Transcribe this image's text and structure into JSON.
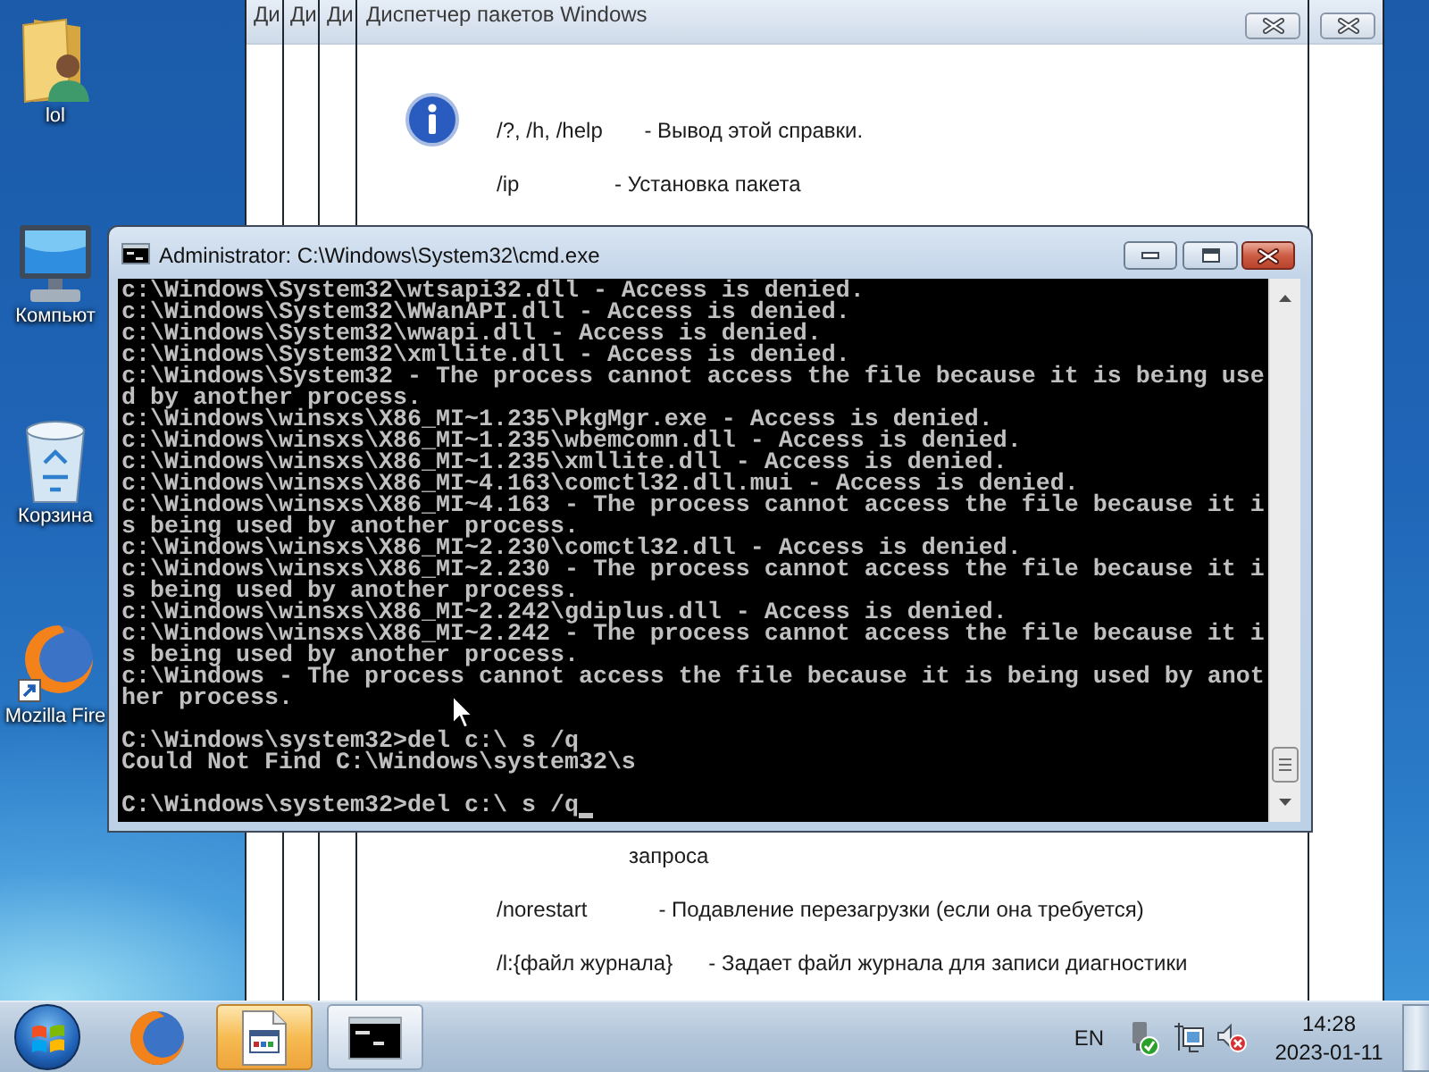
{
  "desktop_icons": [
    {
      "label": "lol",
      "kind": "user-folder"
    },
    {
      "label": "Компьют",
      "kind": "computer"
    },
    {
      "label": "Корзина",
      "kind": "recycle-bin"
    },
    {
      "label": "Mozilla Fire",
      "kind": "browser-shortcut"
    }
  ],
  "background_dialogs": [
    {
      "title": "Ди"
    },
    {
      "title": "Ди"
    },
    {
      "title": "Ди"
    }
  ],
  "package_manager_dialog": {
    "title": "Диспетчер пакетов Windows",
    "help_lines_top": [
      {
        "kind": "option",
        "text": "/?, /h, /help       - Вывод этой справки."
      },
      {
        "kind": "option",
        "text": "/ip                - Установка пакета"
      }
    ],
    "help_lines_bottom": [
      {
        "kind": "continuation",
        "text": "запроса"
      },
      {
        "kind": "option",
        "text": "/norestart            - Подавление перезагрузки (если она требуется)"
      },
      {
        "kind": "option",
        "text": "/l:{файл журнала}      - Задает файл журнала для записи диагностики"
      }
    ]
  },
  "console_window": {
    "title": "Administrator: C:\\Windows\\System32\\cmd.exe",
    "output": [
      "c:\\Windows\\System32\\wtsapi32.dll - Access is denied.",
      "c:\\Windows\\System32\\WWanAPI.dll - Access is denied.",
      "c:\\Windows\\System32\\wwapi.dll - Access is denied.",
      "c:\\Windows\\System32\\xmllite.dll - Access is denied.",
      "c:\\Windows\\System32 - The process cannot access the file because it is being use",
      "d by another process.",
      "c:\\Windows\\winsxs\\X86_MI~1.235\\PkgMgr.exe - Access is denied.",
      "c:\\Windows\\winsxs\\X86_MI~1.235\\wbemcomn.dll - Access is denied.",
      "c:\\Windows\\winsxs\\X86_MI~1.235\\xmllite.dll - Access is denied.",
      "c:\\Windows\\winsxs\\X86_MI~4.163\\comctl32.dll.mui - Access is denied.",
      "c:\\Windows\\winsxs\\X86_MI~4.163 - The process cannot access the file because it i",
      "s being used by another process.",
      "c:\\Windows\\winsxs\\X86_MI~2.230\\comctl32.dll - Access is denied.",
      "c:\\Windows\\winsxs\\X86_MI~2.230 - The process cannot access the file because it i",
      "s being used by another process.",
      "c:\\Windows\\winsxs\\X86_MI~2.242\\gdiplus.dll - Access is denied.",
      "c:\\Windows\\winsxs\\X86_MI~2.242 - The process cannot access the file because it i",
      "s being used by another process.",
      "c:\\Windows - The process cannot access the file because it is being used by anot",
      "her process."
    ],
    "commands": [
      {
        "line": "C:\\Windows\\system32>del c:\\ s /q",
        "output": [
          "Could Not Find C:\\Windows\\system32\\s"
        ],
        "cursor": false
      },
      {
        "line": "C:\\Windows\\system32>del c:\\ s /q",
        "cursor": true
      }
    ]
  },
  "taskbar": {
    "items": [
      {
        "kind": "browser",
        "running": false,
        "flashing": false
      },
      {
        "kind": "package-manager",
        "running": true,
        "flashing": true
      },
      {
        "kind": "console",
        "running": true,
        "flashing": false
      }
    ],
    "tray": {
      "language": "EN",
      "volume_muted": true,
      "time": "14:28",
      "date": "2023-01-11"
    }
  }
}
